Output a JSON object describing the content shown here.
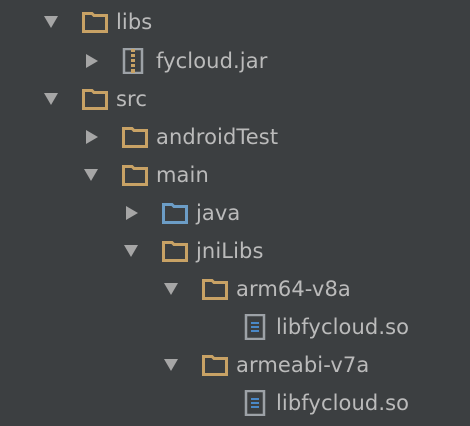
{
  "colors": {
    "background": "#3C3F41",
    "text": "#BBBBBB",
    "arrow": "#A6A6A6",
    "folder": "#C8A265",
    "source_folder": "#6C9DC6",
    "file_icon": "#9DA2A7",
    "file_lines": "#4A88C7"
  },
  "tree": {
    "libs": {
      "label": "libs",
      "state": "expanded",
      "icon": "folder-icon"
    },
    "fycloud_jar": {
      "label": "fycloud.jar",
      "state": "collapsed",
      "icon": "jar-archive-icon"
    },
    "src": {
      "label": "src",
      "state": "expanded",
      "icon": "folder-icon"
    },
    "android_test": {
      "label": "androidTest",
      "state": "collapsed",
      "icon": "folder-icon"
    },
    "main": {
      "label": "main",
      "state": "expanded",
      "icon": "folder-icon"
    },
    "java": {
      "label": "java",
      "state": "collapsed",
      "icon": "source-folder-icon"
    },
    "jni_libs": {
      "label": "jniLibs",
      "state": "expanded",
      "icon": "folder-icon"
    },
    "arm64": {
      "label": "arm64-v8a",
      "state": "expanded",
      "icon": "folder-icon"
    },
    "arm64_so": {
      "label": "libfycloud.so",
      "icon": "file-icon"
    },
    "armeabi": {
      "label": "armeabi-v7a",
      "state": "expanded",
      "icon": "folder-icon"
    },
    "armeabi_so": {
      "label": "libfycloud.so",
      "icon": "file-icon"
    }
  }
}
